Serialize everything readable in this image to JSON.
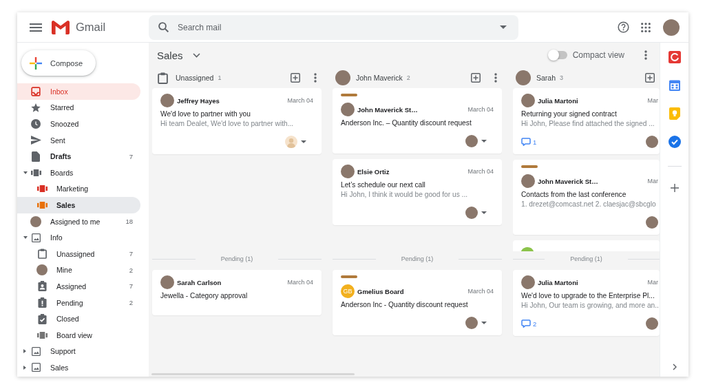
{
  "topbar": {
    "app_name": "Gmail",
    "search": {
      "placeholder": "Search mail"
    }
  },
  "sidebar": {
    "compose": "Compose",
    "items": [
      {
        "label": "Inbox",
        "kind": "inbox",
        "selected": true,
        "unread": false
      },
      {
        "label": "Starred",
        "kind": "star",
        "selected": false,
        "unread": false
      },
      {
        "label": "Snoozed",
        "kind": "clock",
        "selected": false,
        "unread": false
      },
      {
        "label": "Sent",
        "kind": "send",
        "selected": false,
        "unread": false
      },
      {
        "label": "Drafts",
        "kind": "draft",
        "count": "7",
        "selected": false,
        "unread": true
      },
      {
        "label": "Boards",
        "kind": "board",
        "color": "#5f6368",
        "expanded": true,
        "selected": false,
        "unread": false,
        "children": [
          {
            "label": "Marketing",
            "kind": "board",
            "color": "#d93025",
            "selected": false,
            "unread": false
          },
          {
            "label": "Sales",
            "kind": "board",
            "color": "#e8710a",
            "selected": true,
            "unread": false
          }
        ]
      },
      {
        "label": "Assigned to me",
        "kind": "avatar",
        "count": "18",
        "selected": false,
        "unread": false
      },
      {
        "label": "Info",
        "kind": "image",
        "expanded": true,
        "selected": false,
        "unread": false,
        "children": [
          {
            "label": "Unassigned",
            "kind": "clipboard",
            "count": "7",
            "selected": false,
            "unread": false
          },
          {
            "label": "Mine",
            "kind": "avatar",
            "count": "2",
            "selected": false,
            "unread": false
          },
          {
            "label": "Assigned",
            "kind": "assigned",
            "count": "7",
            "selected": false,
            "unread": false
          },
          {
            "label": "Pending",
            "kind": "pending",
            "count": "2",
            "selected": false,
            "unread": false
          },
          {
            "label": "Closed",
            "kind": "closed",
            "selected": false,
            "unread": false
          },
          {
            "label": "Board view",
            "kind": "board",
            "color": "#757575",
            "selected": false,
            "unread": false
          }
        ]
      },
      {
        "label": "Support",
        "kind": "image",
        "expanded": false,
        "selected": false,
        "unread": false
      },
      {
        "label": "Sales",
        "kind": "image",
        "expanded": false,
        "selected": false,
        "unread": false
      }
    ]
  },
  "board": {
    "title": "Sales",
    "compact_view": {
      "label": "Compact view",
      "on": false
    },
    "columns": [
      {
        "kind": "unassigned",
        "name": "Unassigned",
        "count": "1",
        "menu": true,
        "cards": [
          {
            "kind": "email",
            "avatar": {
              "kind": "photo"
            },
            "sender": "Jeffrey Hayes",
            "date": "March 04",
            "subject": "We'd love to partner with you",
            "snippet": "Hi team Dealet, We'd love to partner with...",
            "assignee": {
              "kind": "silhouette",
              "dropdown": true
            }
          }
        ],
        "pending": {
          "label": "Pending (1)",
          "cards": [
            {
              "kind": "email",
              "avatar": {
                "kind": "photo"
              },
              "sender": "Sarah Carlson",
              "date": "March 04",
              "subject": "Jewella - Category approval"
            }
          ]
        }
      },
      {
        "kind": "person",
        "name": "John Maverick",
        "count": "2",
        "menu": true,
        "cards": [
          {
            "kind": "email",
            "label": {
              "color": "#b07a3b"
            },
            "avatar": {
              "kind": "photo"
            },
            "sender": "John Maverick St…",
            "date": "March 04",
            "subject": "Anderson Inc. – Quantity discount request",
            "assignee": {
              "kind": "photo",
              "dropdown": true
            }
          },
          {
            "kind": "email",
            "avatar": {
              "kind": "photo"
            },
            "sender": "Elsie Ortiz",
            "date": "March 04",
            "subject": "Let’s schedule our next call",
            "snippet": "Hi John, I think it would be good for us ...",
            "assignee": {
              "kind": "photo",
              "dropdown": true
            }
          }
        ],
        "pending": {
          "label": "Pending (1)",
          "cards": [
            {
              "kind": "email",
              "label": {
                "color": "#b07a3b"
              },
              "avatar": {
                "kind": "initials",
                "text": "GB",
                "color": "#f2b01e"
              },
              "sender": "Gmelius Board",
              "date": "March 04",
              "subject": "Anderson Inc - Quantity discount request",
              "assignee": {
                "kind": "photo",
                "dropdown": true
              }
            }
          ]
        }
      },
      {
        "kind": "person",
        "name": "Sarah",
        "count": "3",
        "menu": false,
        "cards": [
          {
            "kind": "email",
            "avatar": {
              "kind": "photo"
            },
            "sender": "Julia Martoni",
            "date": "Mar",
            "subject": "Returning your signed contract",
            "snippet": "Hi John, Please find attached the signed ...",
            "comments": "1",
            "assignee": {
              "kind": "photo",
              "dropdown": false
            }
          },
          {
            "kind": "email",
            "label": {
              "color": "#b07a3b"
            },
            "avatar": {
              "kind": "photo"
            },
            "sender": "John Maverick St…",
            "date": "Mar",
            "subject": "Contacts from the last conference",
            "snippet": "1. drezet@comcast.net 2. claesjac@sbcglo",
            "assignee": {
              "kind": "photo",
              "dropdown": false
            }
          },
          {
            "kind": "clipped",
            "avatar": {
              "color": "#8bc34a"
            }
          }
        ],
        "pending": {
          "label": "Pending (1)",
          "cards": [
            {
              "kind": "email",
              "avatar": {
                "kind": "photo"
              },
              "sender": "Julia Martoni",
              "date": "Mar",
              "subject": "We'd love to upgrade to the Enterprise Pl...",
              "snippet": "Hi John, Our team is growing, and more an...",
              "comments": "2",
              "assignee": {
                "kind": "photo",
                "dropdown": false
              }
            }
          ]
        }
      }
    ]
  }
}
